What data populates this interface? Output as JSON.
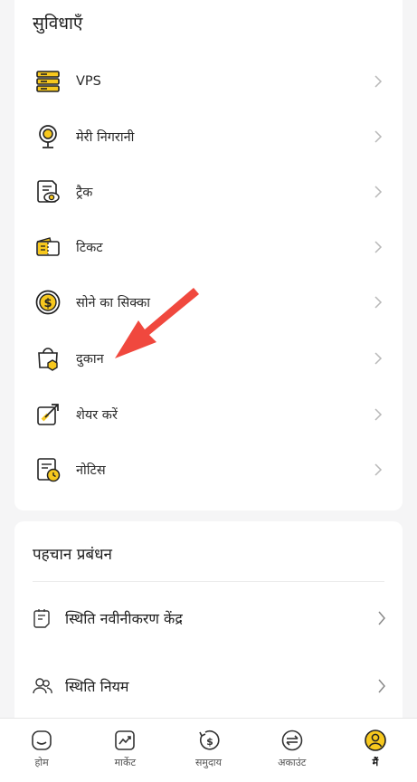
{
  "features": {
    "title": "सुविधाएँ",
    "items": [
      {
        "label": "VPS",
        "icon": "server-icon"
      },
      {
        "label": "मेरी निगरानी",
        "icon": "webcam-icon"
      },
      {
        "label": "ट्रैक",
        "icon": "track-eye-icon"
      },
      {
        "label": "टिकट",
        "icon": "ticket-icon"
      },
      {
        "label": "सोने का सिक्का",
        "icon": "gold-coin-icon"
      },
      {
        "label": "दुकान",
        "icon": "shop-bag-icon"
      },
      {
        "label": "शेयर करें",
        "icon": "share-icon"
      },
      {
        "label": "नोटिस",
        "icon": "notice-icon"
      }
    ]
  },
  "identity": {
    "title": "पहचान प्रबंधन",
    "items": [
      {
        "label": "स्थिति नवीनीकरण केंद्र",
        "icon": "renewal-doc-icon"
      },
      {
        "label": "स्थिति नियम",
        "icon": "users-icon"
      }
    ]
  },
  "nav": {
    "items": [
      {
        "label": "होम",
        "icon": "home-icon",
        "active": false
      },
      {
        "label": "मार्केट",
        "icon": "market-chart-icon",
        "active": false
      },
      {
        "label": "समुदाय",
        "icon": "community-coin-icon",
        "active": false
      },
      {
        "label": "अकाउंट",
        "icon": "account-exchange-icon",
        "active": false
      },
      {
        "label": "मैं",
        "icon": "profile-icon",
        "active": true
      }
    ]
  },
  "colors": {
    "accent": "#f7c81e",
    "annotation_arrow": "#f0483e",
    "chevron": "#b8b8b8"
  }
}
